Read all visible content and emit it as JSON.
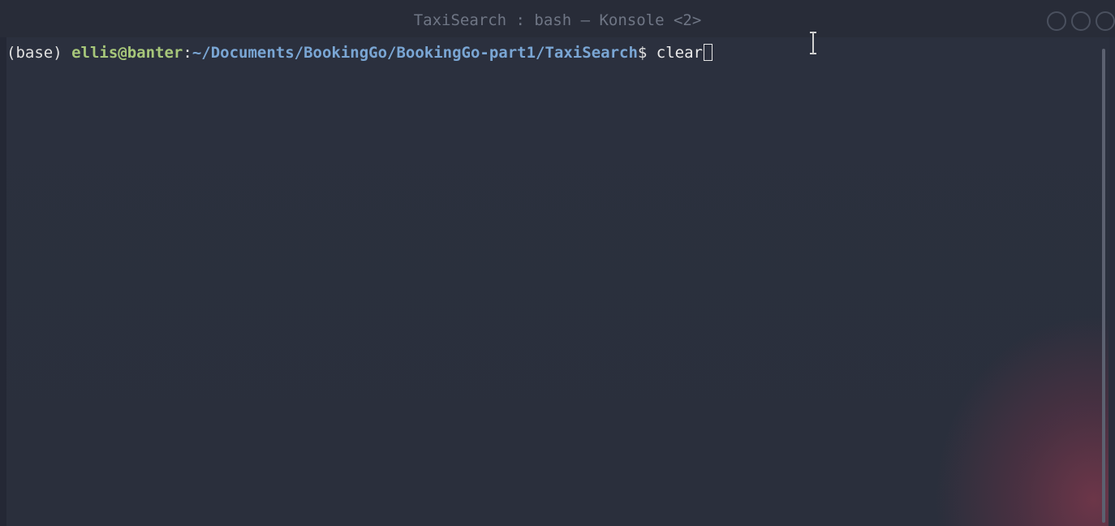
{
  "window": {
    "title": "TaxiSearch : bash — Konsole <2>",
    "controls": [
      "minimize",
      "maximize",
      "close"
    ]
  },
  "terminal": {
    "prompt": {
      "env": "(base) ",
      "user_host": "ellis@banter",
      "colon": ":",
      "path": "~/Documents/BookingGo/BookingGo-part1/TaxiSearch",
      "dollar": "$ "
    },
    "command": "clear"
  },
  "colors": {
    "background": "#2b303e",
    "user_host": "#a7c77a",
    "path": "#7aa6d4",
    "text": "#e6e6e6",
    "title": "#6f7685"
  },
  "icons": {
    "mouse_cursor": "text-ibeam-icon",
    "window_buttons": "circle-outline-icon"
  }
}
